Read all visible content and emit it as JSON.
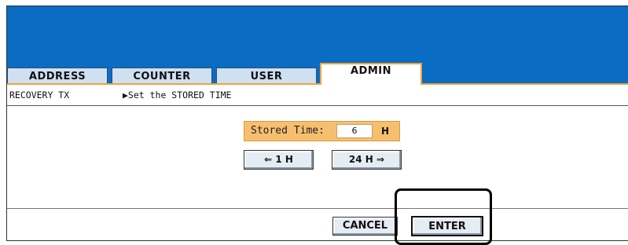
{
  "tabs": [
    {
      "label": "ADDRESS",
      "active": false
    },
    {
      "label": "COUNTER",
      "active": false
    },
    {
      "label": "USER",
      "active": false
    },
    {
      "label": "ADMIN",
      "active": true
    }
  ],
  "info": {
    "menu": "RECOVERY TX",
    "instruction": "▶Set the STORED TIME"
  },
  "stored": {
    "label": "Stored Time:",
    "value": "6",
    "unit": "H"
  },
  "buttons": {
    "dec_label": "⇐ 1 H",
    "inc_label": "24 H ⇒",
    "cancel_label": "CANCEL",
    "enter_label": "ENTER"
  },
  "colors": {
    "header": "#0a6cc2",
    "panel": "#f6bf70",
    "active_tab_border": "#f0a23a",
    "tab_inactive": "#cfe0f1"
  }
}
